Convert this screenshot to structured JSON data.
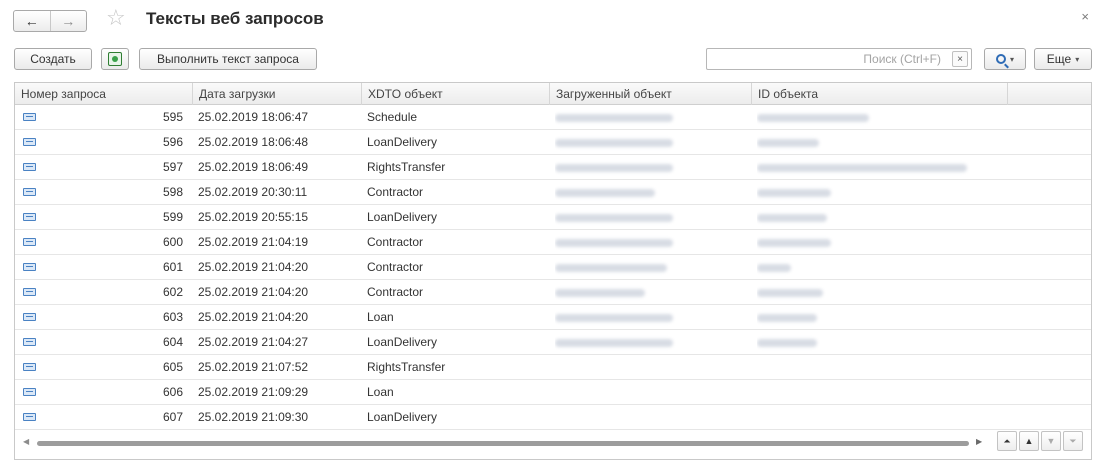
{
  "window": {
    "title": "Тексты веб запросов",
    "close_glyph": "×"
  },
  "nav": {
    "back_glyph": "←",
    "forward_glyph": "→",
    "favorite_glyph": "☆"
  },
  "toolbar": {
    "create_label": "Создать",
    "export_icon": "excel-icon",
    "execute_label": "Выполнить текст запроса",
    "search_placeholder": "Поиск (Ctrl+F)",
    "search_clear": "×",
    "search_caret": "▾",
    "more_label": "Еще",
    "more_caret": "▾"
  },
  "table": {
    "columns": [
      "Номер запроса",
      "Дата загрузки",
      "XDTO объект",
      "Загруженный объект",
      "ID объекта"
    ],
    "rows": [
      {
        "num": "595",
        "date": "25.02.2019 18:06:47",
        "xdto": "Schedule"
      },
      {
        "num": "596",
        "date": "25.02.2019 18:06:48",
        "xdto": "LoanDelivery"
      },
      {
        "num": "597",
        "date": "25.02.2019 18:06:49",
        "xdto": "RightsTransfer"
      },
      {
        "num": "598",
        "date": "25.02.2019 20:30:11",
        "xdto": "Contractor"
      },
      {
        "num": "599",
        "date": "25.02.2019 20:55:15",
        "xdto": "LoanDelivery"
      },
      {
        "num": "600",
        "date": "25.02.2019 21:04:19",
        "xdto": "Contractor"
      },
      {
        "num": "601",
        "date": "25.02.2019 21:04:20",
        "xdto": "Contractor"
      },
      {
        "num": "602",
        "date": "25.02.2019 21:04:20",
        "xdto": "Contractor"
      },
      {
        "num": "603",
        "date": "25.02.2019 21:04:20",
        "xdto": "Loan"
      },
      {
        "num": "604",
        "date": "25.02.2019 21:04:27",
        "xdto": "LoanDelivery"
      },
      {
        "num": "605",
        "date": "25.02.2019 21:07:52",
        "xdto": "RightsTransfer"
      },
      {
        "num": "606",
        "date": "25.02.2019 21:09:29",
        "xdto": "Loan"
      },
      {
        "num": "607",
        "date": "25.02.2019 21:09:30",
        "xdto": "LoanDelivery"
      }
    ]
  },
  "pager": {
    "first_glyph": "⏶",
    "up_glyph": "▲",
    "down_glyph": "▼",
    "last_glyph": "⏷"
  }
}
